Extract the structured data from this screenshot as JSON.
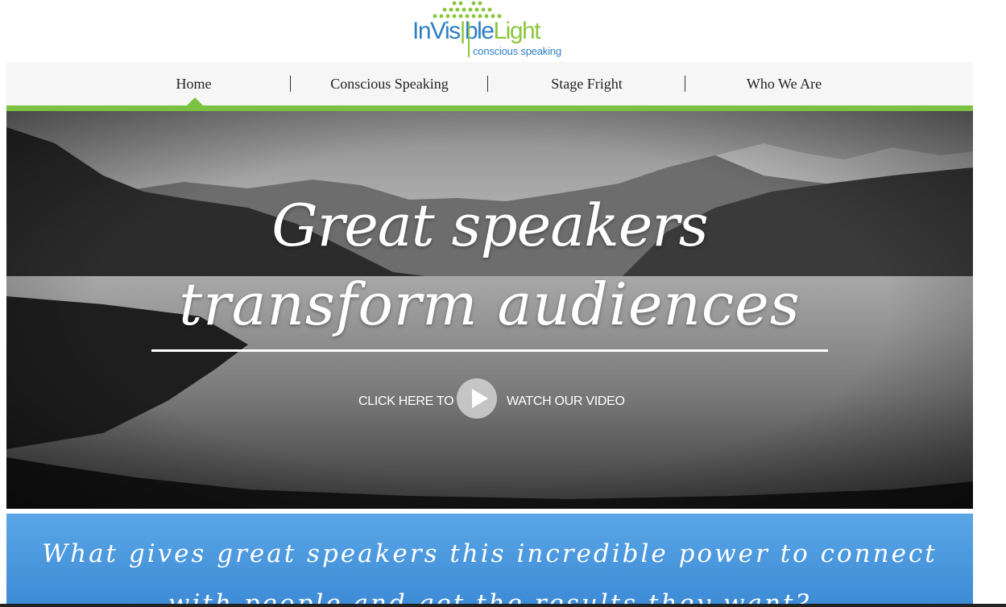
{
  "logo": {
    "word_part1": "InVis",
    "word_part2": "ble",
    "word_part3": "Light",
    "tagline": "conscious speaking",
    "colors": {
      "blue": "#2d7fc4",
      "green": "#8cc63f"
    }
  },
  "nav": {
    "items": [
      {
        "label": "Home",
        "active": true
      },
      {
        "label": "Conscious Speaking"
      },
      {
        "label": "Stage Fright"
      },
      {
        "label": "Who We Are"
      }
    ],
    "accent": "#7cc242"
  },
  "hero": {
    "line1": "Great speakers",
    "line2": "transform audiences",
    "cta_left": "CLICK HERE TO",
    "cta_right": "WATCH OUR VIDEO",
    "play_icon": "play-icon"
  },
  "band": {
    "line1": "What gives great speakers this incredible power to connect",
    "line2": "with people and get the results they want?",
    "color": "#4a95dc"
  }
}
